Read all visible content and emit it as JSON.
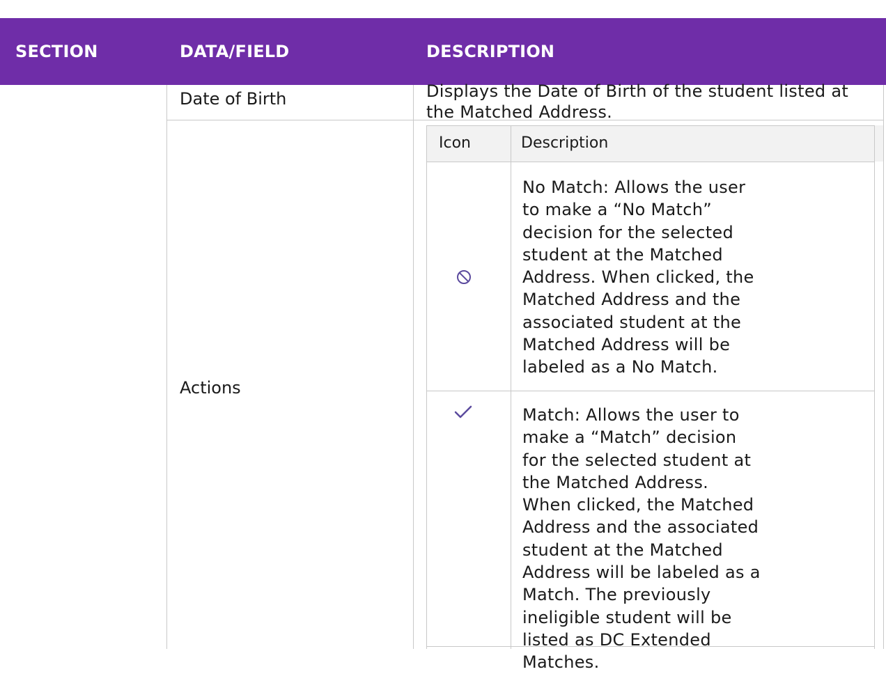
{
  "header": {
    "section": "SECTION",
    "data_field": "DATA/FIELD",
    "description": "DESCRIPTION"
  },
  "rows": {
    "date_of_birth": {
      "field": "Date of Birth",
      "description": "Displays the Date of Birth of the student listed at the Matched Address."
    },
    "actions": {
      "field": "Actions",
      "inner_table": {
        "col_icon": "Icon",
        "col_description": "Description",
        "items": [
          {
            "icon": "no-match-icon",
            "description": "No Match: Allows the user to make a “No Match” decision for the selected student at the Matched Address. When clicked, the Matched Address and the associated student at the Matched Address will be labeled as a No Match."
          },
          {
            "icon": "checkmark-icon",
            "description": "Match:  Allows the user to make a “Match” decision for the selected student at the Matched Address. When clicked, the Matched Address and the associated student at the Matched Address will be labeled as a Match. The previously ineligible student will be listed as DC Extended Matches."
          }
        ]
      }
    }
  },
  "colors": {
    "header_bg": "#6f2da8",
    "icon_color": "#5b4a9e"
  }
}
